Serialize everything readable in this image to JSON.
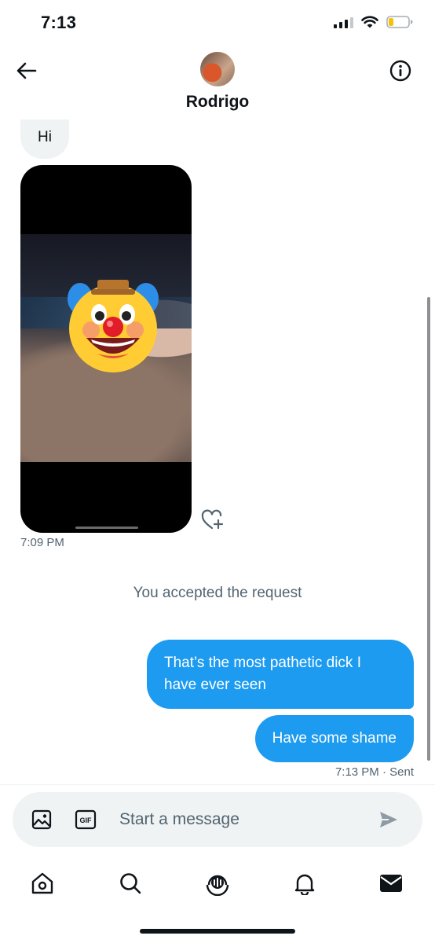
{
  "status_bar": {
    "time": "7:13"
  },
  "header": {
    "contact_name": "Rodrigo"
  },
  "messages": {
    "incoming_text": "Hi",
    "incoming_time": "7:09 PM",
    "system": "You accepted the request",
    "outgoing": [
      {
        "text": "That’s the most pathetic dick I have ever seen"
      },
      {
        "text": "Have some shame"
      }
    ],
    "outgoing_meta": "7:13 PM · Sent"
  },
  "composer": {
    "placeholder": "Start a message",
    "gif_label": "GIF"
  },
  "colors": {
    "accent": "#1d9bf0",
    "bubble_in": "#eff3f4",
    "muted_text": "#536471"
  },
  "icons": [
    "back-arrow-icon",
    "info-icon",
    "heart-plus-icon",
    "image-icon",
    "gif-icon",
    "send-icon",
    "home-icon",
    "search-icon",
    "spaces-icon",
    "bell-icon",
    "mail-icon"
  ]
}
